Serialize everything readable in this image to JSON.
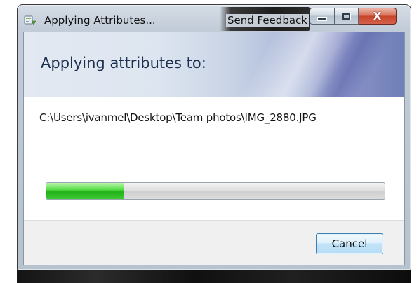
{
  "window": {
    "title": "Applying Attributes...",
    "send_feedback": "Send Feedback",
    "caption": {
      "minimize": "minimize-icon",
      "maximize": "maximize-icon",
      "close": "close-icon",
      "close_glyph": "X"
    }
  },
  "dialog": {
    "heading": "Applying attributes to:",
    "file_path": "C:\\Users\\ivanmel\\Desktop\\Team photos\\IMG_2880.JPG",
    "progress_fraction": 0.23,
    "progress_color": "#2fbf22",
    "cancel_label": "Cancel"
  }
}
